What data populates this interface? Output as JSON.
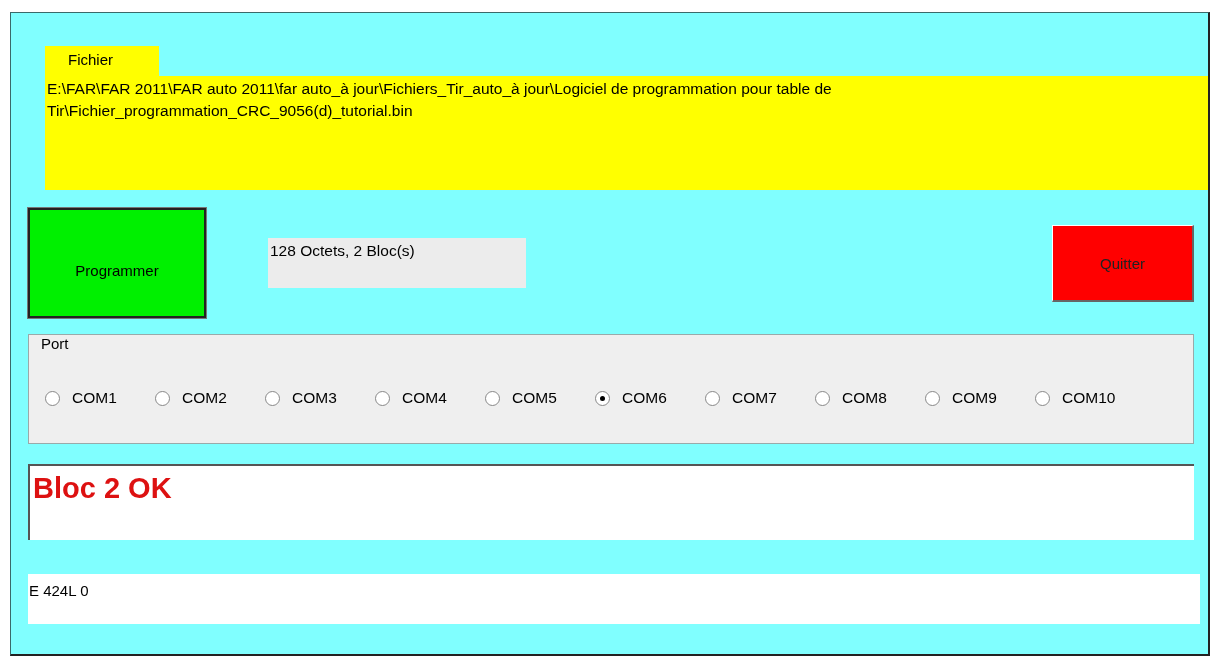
{
  "file": {
    "label": "Fichier",
    "path": "E:\\FAR\\FAR 2011\\FAR auto 2011\\far auto_à jour\\Fichiers_Tir_auto_à jour\\Logiciel de programmation pour table de Tir\\Fichier_programmation_CRC_9056(d)_tutorial.bin"
  },
  "program_button": "Programmer",
  "info": "128 Octets, 2 Bloc(s)",
  "quit_button": "Quitter",
  "port": {
    "label": "Port",
    "options": [
      {
        "label": "COM1",
        "selected": false
      },
      {
        "label": "COM2",
        "selected": false
      },
      {
        "label": "COM3",
        "selected": false
      },
      {
        "label": "COM4",
        "selected": false
      },
      {
        "label": "COM5",
        "selected": false
      },
      {
        "label": "COM6",
        "selected": true
      },
      {
        "label": "COM7",
        "selected": false
      },
      {
        "label": "COM8",
        "selected": false
      },
      {
        "label": "COM9",
        "selected": false
      },
      {
        "label": "COM10",
        "selected": false
      }
    ]
  },
  "status": "Bloc 2 OK",
  "log": "E 424L 0"
}
